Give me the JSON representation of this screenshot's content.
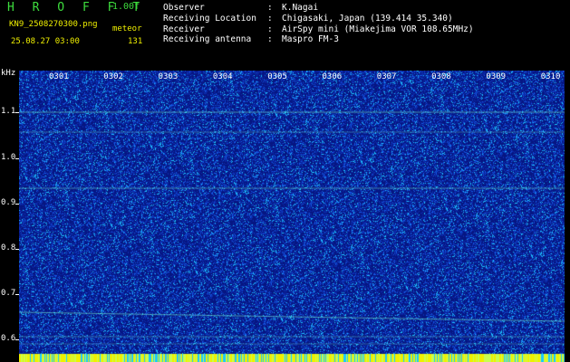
{
  "header": {
    "brand": "H R O F F T",
    "version": "1.00f",
    "filename": "KN9_2508270300.png",
    "meteor_label": "meteor",
    "timestamp": "25.08.27 03:00",
    "meteor_count": "131"
  },
  "info": [
    {
      "key": "Observer",
      "value": "K.Nagai"
    },
    {
      "key": "Receiving Location",
      "value": "Chigasaki, Japan (139.414 35.340)"
    },
    {
      "key": "Receiver",
      "value": "AirSpy mini (Miakejima VOR 108.65MHz)"
    },
    {
      "key": "Receiving antenna",
      "value": "Maspro FM-3"
    }
  ],
  "axis": {
    "y_unit": "kHz",
    "y_ticks": [
      "1.1",
      "1.0",
      "0.9",
      "0.8",
      "0.7",
      "0.6"
    ],
    "x_ticks": [
      "0301",
      "0302",
      "0303",
      "0304",
      "0305",
      "0306",
      "0307",
      "0308",
      "0309",
      "0310"
    ]
  },
  "colors": {
    "background": "#0a1f8f",
    "noise_cyan": "#19c8ff",
    "trace": "#7dffd2",
    "brand": "#3ddc3d",
    "highlight": "#f0f000"
  }
}
